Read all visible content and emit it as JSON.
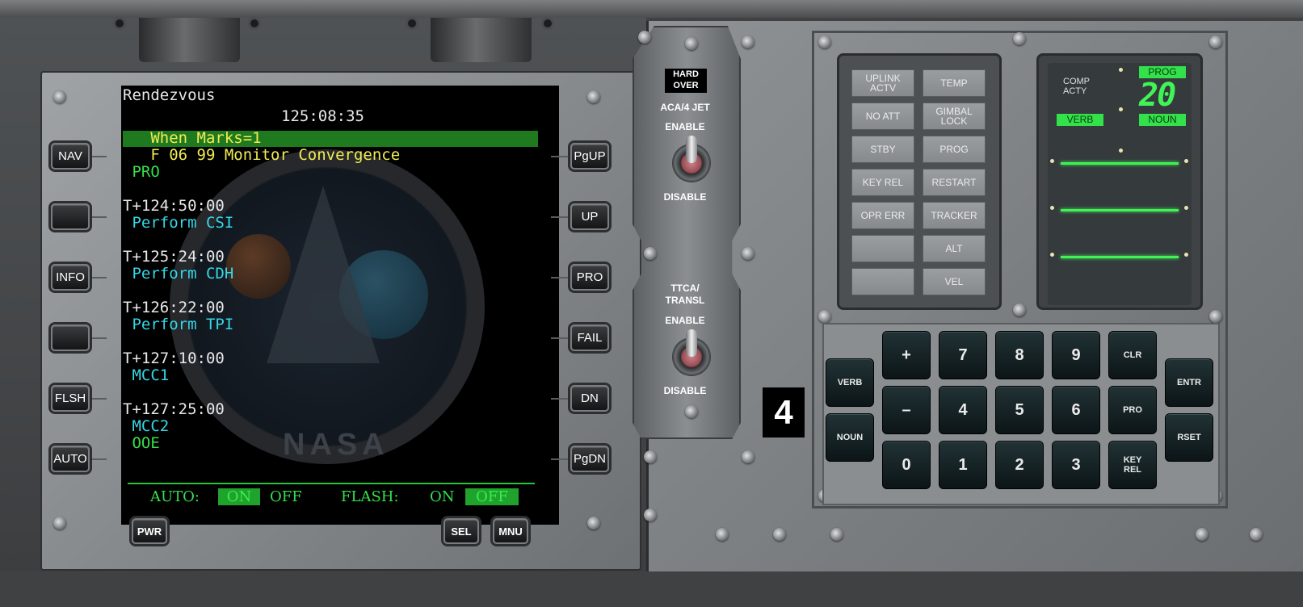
{
  "mfd": {
    "title": "Rendezvous",
    "time": "125:08:35",
    "highlight_line": "   When Marks=1",
    "current_step": "   F 06 99 Monitor Convergence",
    "current_action": " PRO",
    "events": [
      {
        "time": "T+124:50:00",
        "action": " Perform CSI"
      },
      {
        "time": "T+125:24:00",
        "action": " Perform CDH"
      },
      {
        "time": "T+126:22:00",
        "action": " Perform TPI"
      },
      {
        "time": "T+127:10:00",
        "action": " MCC1"
      },
      {
        "time": "T+127:25:00",
        "action": " MCC2",
        "action2": " OOE"
      }
    ],
    "status": {
      "auto_label": "AUTO:",
      "auto_on": "ON",
      "auto_off": "OFF",
      "flash_label": "FLASH:",
      "flash_on": "ON",
      "flash_off": "OFF"
    },
    "emblem_text": "NASA",
    "left_buttons": [
      "NAV",
      "",
      "INFO",
      "",
      "FLSH",
      "AUTO"
    ],
    "right_buttons": [
      "PgUP",
      "UP",
      "PRO",
      "FAIL",
      "DN",
      "PgDN"
    ],
    "bottom_buttons": {
      "pwr": "PWR",
      "sel": "SEL",
      "mnu": "MNU"
    }
  },
  "switch_panel": {
    "hard_over": "HARD\nOVER",
    "aca_label": "ACA/4 JET",
    "aca_enable": "ENABLE",
    "aca_disable": "DISABLE",
    "ttca_label": "TTCA/\nTRANSL",
    "ttca_enable": "ENABLE",
    "ttca_disable": "DISABLE",
    "panel_number": "4"
  },
  "dsky": {
    "lamps_left": [
      "UPLINK\nACTV",
      "NO ATT",
      "STBY",
      "KEY REL",
      "OPR ERR",
      "",
      ""
    ],
    "lamps_right": [
      "TEMP",
      "GIMBAL\nLOCK",
      "PROG",
      "RESTART",
      "TRACKER",
      "ALT",
      "VEL"
    ],
    "comp_acty": "COMP\nACTY",
    "prog_label": "PROG",
    "prog_value": "20",
    "verb_label": "VERB",
    "noun_label": "NOUN",
    "keys": {
      "verb": "VERB",
      "noun": "NOUN",
      "plus": "+",
      "minus": "–",
      "row1": [
        "7",
        "8",
        "9"
      ],
      "row2": [
        "4",
        "5",
        "6"
      ],
      "row3": [
        "0",
        "1",
        "2",
        "3"
      ],
      "clr": "CLR",
      "pro": "PRO",
      "key_rel": "KEY\nREL",
      "entr": "ENTR",
      "rset": "RSET"
    }
  },
  "colors": {
    "screen_bg": "#000000",
    "text_white": "#e8e8e8",
    "text_yellow": "#f2ec52",
    "text_green": "#35e04a",
    "text_cyan": "#34d8e8",
    "dsky_green": "#3ff255",
    "panel_gray": "#8e9295"
  }
}
